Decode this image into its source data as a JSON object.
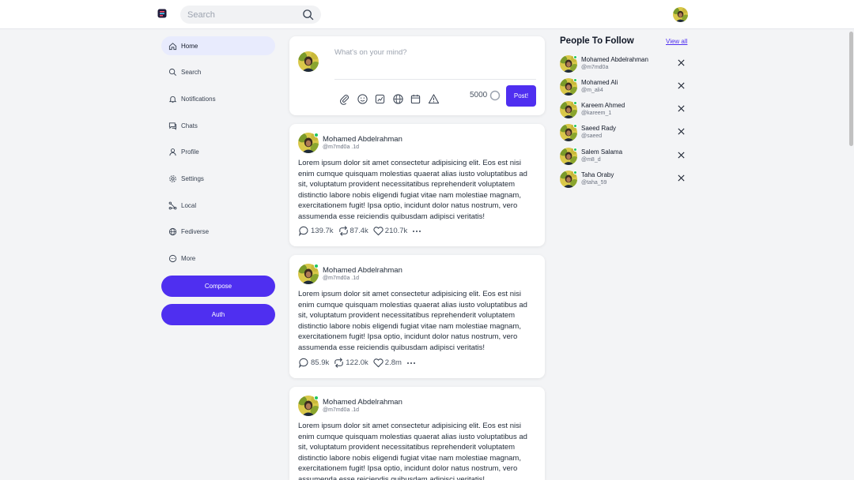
{
  "header": {
    "search_placeholder": "Search",
    "logo_icon": "app-logo",
    "accent": "#4f2ff0"
  },
  "sidebar": {
    "items": [
      {
        "label": "Home",
        "icon": "home-icon",
        "active": true
      },
      {
        "label": "Search",
        "icon": "search-icon"
      },
      {
        "label": "Notifications",
        "icon": "bell-icon"
      },
      {
        "label": "Chats",
        "icon": "chat-icon"
      },
      {
        "label": "Profile",
        "icon": "user-icon"
      },
      {
        "label": "Settings",
        "icon": "gear-icon"
      },
      {
        "label": "Local",
        "icon": "local-icon"
      },
      {
        "label": "Fediverse",
        "icon": "globe-icon"
      },
      {
        "label": "More",
        "icon": "more-circle-icon"
      }
    ],
    "compose_label": "Compose",
    "auth_label": "Auth"
  },
  "composer": {
    "placeholder": "What's on your mind?",
    "char_count": "5000",
    "post_label": "Post!",
    "tools": [
      "attachment-icon",
      "emoji-icon",
      "chart-icon",
      "globe-icon",
      "calendar-icon",
      "warning-icon"
    ]
  },
  "posts": [
    {
      "name": "Mohamed Abdelrahman",
      "handle": "@m7md0a .1d",
      "body": "Lorem ipsum dolor sit amet consectetur adipisicing elit. Eos est nisi enim cumque quisquam molestias quaerat alias iusto voluptatibus ad sit, voluptatum provident necessitatibus reprehenderit voluptatem distinctio labore nobis eligendi fugiat vitae nam molestiae magnam, exercitationem fugit! Ipsa optio, incidunt dolor natus nostrum, vero assumenda esse reiciendis quibusdam adipisci veritatis!",
      "replies": "139.7k",
      "reposts": "87.4k",
      "likes": "210.7k"
    },
    {
      "name": "Mohamed Abdelrahman",
      "handle": "@m7md0a .1d",
      "body": "Lorem ipsum dolor sit amet consectetur adipisicing elit. Eos est nisi enim cumque quisquam molestias quaerat alias iusto voluptatibus ad sit, voluptatum provident necessitatibus reprehenderit voluptatem distinctio labore nobis eligendi fugiat vitae nam molestiae magnam, exercitationem fugit! Ipsa optio, incidunt dolor natus nostrum, vero assumenda esse reiciendis quibusdam adipisci veritatis!",
      "replies": "85.9k",
      "reposts": "122.0k",
      "likes": "2.8m"
    },
    {
      "name": "Mohamed Abdelrahman",
      "handle": "@m7md0a .1d",
      "body": "Lorem ipsum dolor sit amet consectetur adipisicing elit. Eos est nisi enim cumque quisquam molestias quaerat alias iusto voluptatibus ad sit, voluptatum provident necessitatibus reprehenderit voluptatem distinctio labore nobis eligendi fugiat vitae nam molestiae magnam, exercitationem fugit! Ipsa optio, incidunt dolor natus nostrum, vero assumenda esse reiciendis quibusdam adipisci veritatis!"
    }
  ],
  "follow": {
    "title": "People To Follow",
    "view_all": "View all",
    "people": [
      {
        "name": "Mohamed Abdelrahman",
        "handle": "@m7md0a"
      },
      {
        "name": "Mohamed Ali",
        "handle": "@m_ali4"
      },
      {
        "name": "Kareem Ahmed",
        "handle": "@kareem_1"
      },
      {
        "name": "Saeed Rady",
        "handle": "@saeed"
      },
      {
        "name": "Salem Salama",
        "handle": "@m8_d"
      },
      {
        "name": "Taha Oraby",
        "handle": "@taha_59"
      }
    ]
  }
}
